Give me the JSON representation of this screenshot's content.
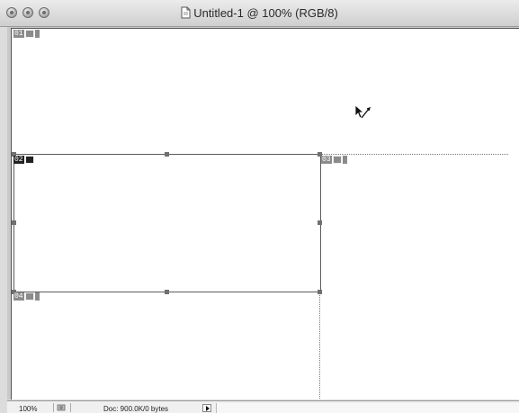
{
  "window": {
    "title": "Untitled-1 @ 100% (RGB/8)"
  },
  "slices": [
    {
      "number": "01",
      "active": false
    },
    {
      "number": "02",
      "active": true
    },
    {
      "number": "03",
      "active": false
    },
    {
      "number": "04",
      "active": false
    }
  ],
  "statusbar": {
    "zoom": "100%",
    "doc_info": "Doc: 900.0K/0 bytes"
  },
  "icons": {
    "document": "document-icon",
    "cursor": "slice-select-cursor-icon",
    "status": "status-icon",
    "menu_arrow": "triangle-right-icon"
  }
}
